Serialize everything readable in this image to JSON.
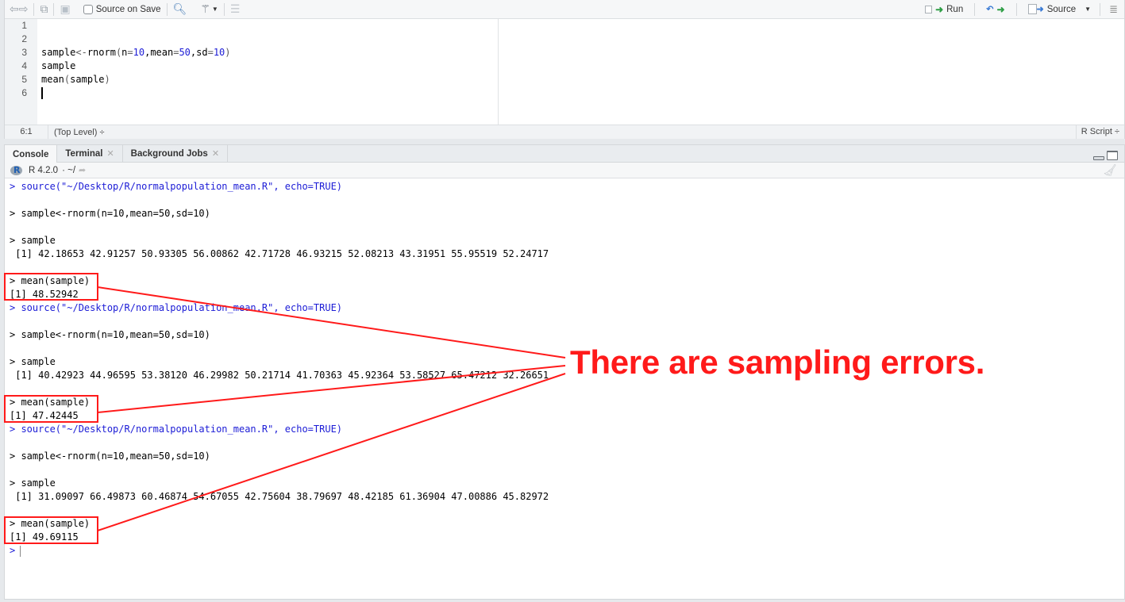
{
  "editor": {
    "toolbar": {
      "back_icon": "back-arrow-icon",
      "forward_icon": "forward-arrow-icon",
      "show_in_window_icon": "popout-icon",
      "save_icon": "save-icon",
      "source_on_save_label": "Source on Save",
      "source_on_save_checked": false,
      "search_icon": "magnifier-icon",
      "code_tools_icon": "magic-wand-icon",
      "compile_report_icon": "notebook-icon",
      "run_label": "Run",
      "rerun_icon": "rerun-icon",
      "source_label": "Source",
      "outline_icon": "outline-icon"
    },
    "line_numbers": [
      "1",
      "2",
      "3",
      "4",
      "5",
      "6"
    ],
    "code_lines": [
      "",
      "",
      "sample<-rnorm(n=10,mean=50,sd=10)",
      "sample",
      "mean(sample)",
      ""
    ],
    "status": {
      "cursor_position": "6:1",
      "scope": "(Top Level) ÷",
      "file_type": "R Script ÷"
    }
  },
  "console": {
    "tabs": [
      {
        "label": "Console",
        "active": true,
        "closable": false
      },
      {
        "label": "Terminal",
        "active": false,
        "closable": true
      },
      {
        "label": "Background Jobs",
        "active": false,
        "closable": true
      }
    ],
    "r_version": "R 4.2.0",
    "working_dir": "· ~/",
    "runs": [
      {
        "source_cmd": "> source(\"~/Desktop/R/normalpopulation_mean.R\", echo=TRUE)",
        "assign_cmd": "> sample<-rnorm(n=10,mean=50,sd=10)",
        "print_cmd": "> sample",
        "sample_output": " [1] 42.18653 42.91257 50.93305 56.00862 42.71728 46.93215 52.08213 43.31951 55.95519 52.24717",
        "mean_cmd": "> mean(sample)",
        "mean_output": "[1] 48.52942"
      },
      {
        "source_cmd": "> source(\"~/Desktop/R/normalpopulation_mean.R\", echo=TRUE)",
        "assign_cmd": "> sample<-rnorm(n=10,mean=50,sd=10)",
        "print_cmd": "> sample",
        "sample_output": " [1] 40.42923 44.96595 53.38120 46.29982 50.21714 41.70363 45.92364 53.58527 65.47212 32.26651",
        "mean_cmd": "> mean(sample)",
        "mean_output": "[1] 47.42445"
      },
      {
        "source_cmd": "> source(\"~/Desktop/R/normalpopulation_mean.R\", echo=TRUE)",
        "assign_cmd": "> sample<-rnorm(n=10,mean=50,sd=10)",
        "print_cmd": "> sample",
        "sample_output": " [1] 31.09097 66.49873 60.46874 54.67055 42.75604 38.79697 48.42185 61.36904 47.00886 45.82972",
        "mean_cmd": "> mean(sample)",
        "mean_output": "[1] 49.69115"
      }
    ],
    "prompt": ">"
  },
  "annotation": {
    "text": "There are sampling errors.",
    "color": "#ff1a1a"
  },
  "colors": {
    "code_number": "#1c1cd6",
    "console_echo": "#1c1cd6",
    "run_arrow": "#2e9e45"
  }
}
